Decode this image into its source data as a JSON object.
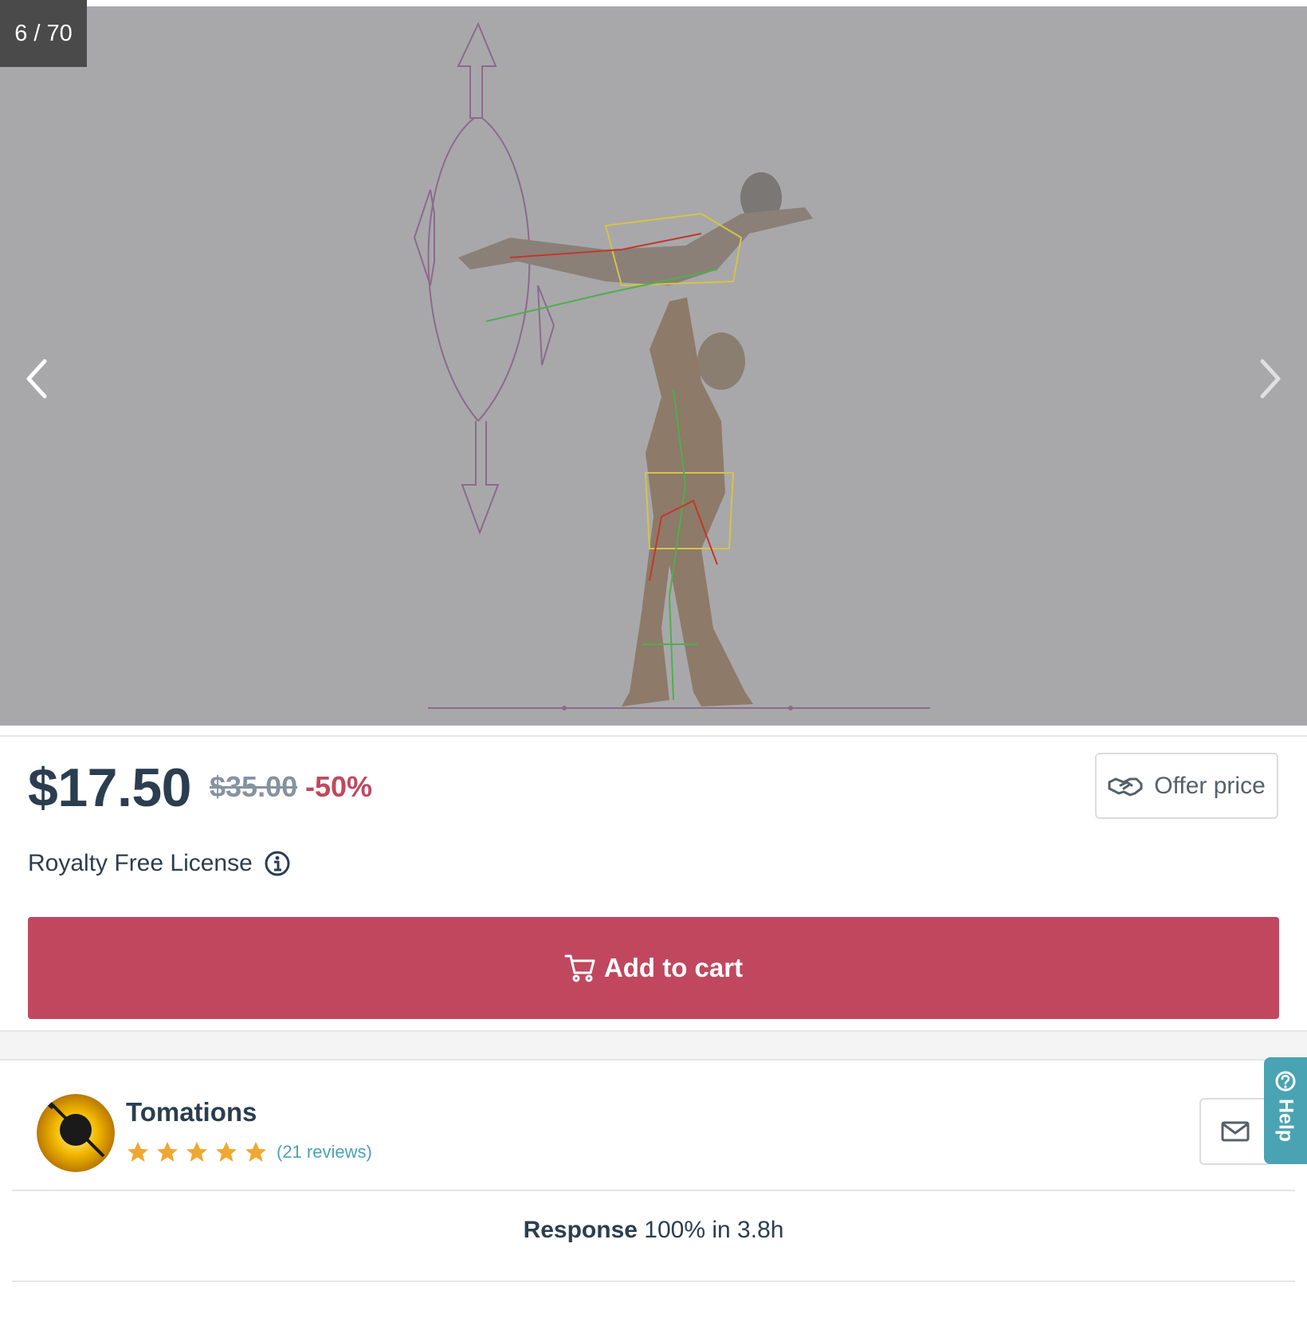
{
  "gallery": {
    "counter": "6 / 70",
    "prev_icon": "chevron-left-icon",
    "next_icon": "chevron-right-icon",
    "background": "#a8a8aa"
  },
  "pricing": {
    "current_price": "$17.50",
    "original_price": "$35.00",
    "discount": "-50%",
    "offer_label": "Offer price",
    "offer_icon": "handshake-icon"
  },
  "license": {
    "label": "Royalty Free License",
    "icon": "info-icon"
  },
  "cart": {
    "label": "Add to cart",
    "icon": "cart-icon"
  },
  "seller": {
    "name": "Tomations",
    "rating": 5,
    "rating_max": 5,
    "reviews": "(21 reviews)",
    "message_icon": "envelope-icon"
  },
  "help": {
    "label": "Help",
    "icon": "question-circle-icon"
  },
  "response": {
    "label": "Response",
    "value": "100% in 3.8h"
  },
  "colors": {
    "accent": "#c1475f",
    "teal": "#4aa3b2",
    "text": "#2b3e50",
    "star": "#f0a732"
  }
}
